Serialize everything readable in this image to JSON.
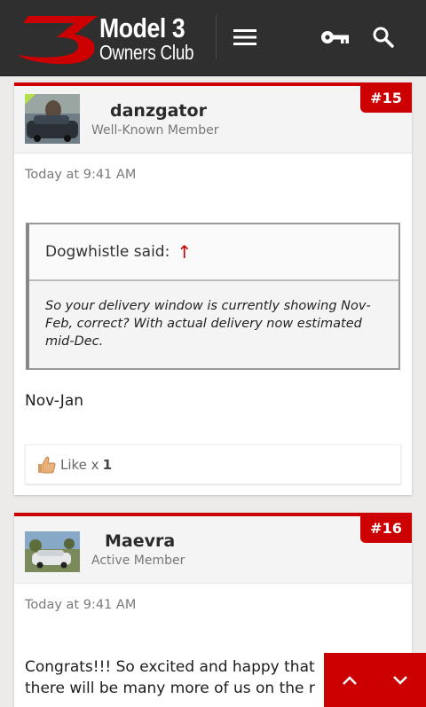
{
  "header": {
    "logo_line1": "Model 3",
    "logo_line2": "Owners Club",
    "menu_icon": "hamburger-menu-icon",
    "login_icon": "key-icon",
    "search_icon": "search-icon"
  },
  "posts": [
    {
      "number": "#15",
      "username": "danzgator",
      "user_title": "Well-Known Member",
      "date": "Today at 9:41 AM",
      "quote": {
        "author_said": "Dogwhistle said:",
        "arrow": "↑",
        "text": "So your delivery window is currently showing Nov-Feb, correct? With actual delivery now estimated mid-Dec."
      },
      "message": "Nov-Jan",
      "likes_label": "Like x",
      "likes_count": "1"
    },
    {
      "number": "#16",
      "username": "Maevra",
      "user_title": "Active Member",
      "date": "Today at 9:41 AM",
      "message_line1": "Congrats!!! So excited and happy that",
      "message_line2": "there will be many more of us on the r"
    }
  ],
  "colors": {
    "accent": "#cc0000",
    "header_bg": "#2f2f2f",
    "page_bg": "#ecebea"
  }
}
